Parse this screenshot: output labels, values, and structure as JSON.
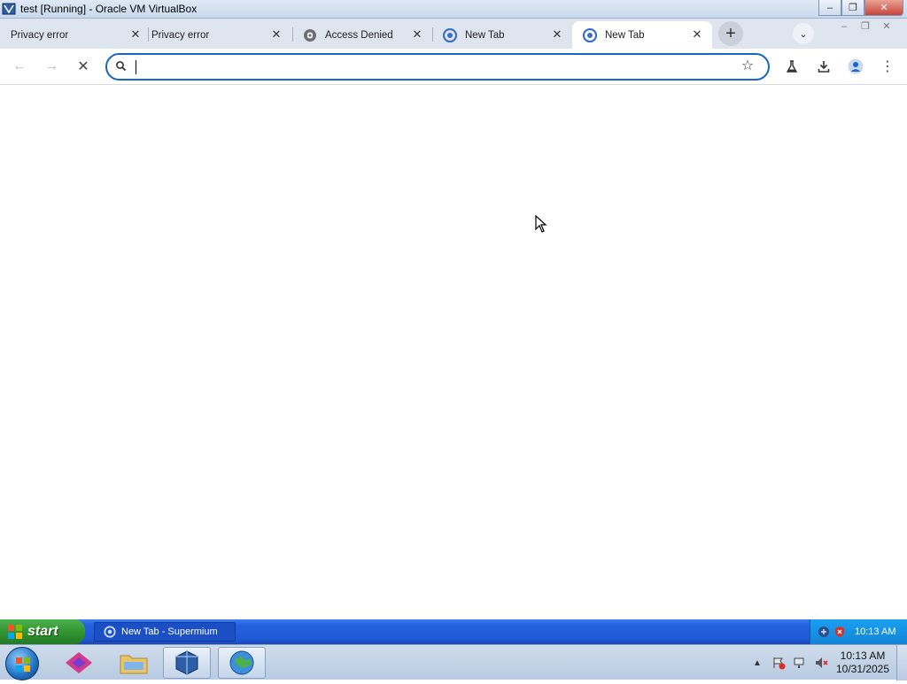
{
  "vbox": {
    "title": "test [Running] - Oracle VM VirtualBox",
    "icon": "virtualbox-icon"
  },
  "tabs": [
    {
      "title": "Privacy error",
      "favicon": "none",
      "active": false
    },
    {
      "title": "Privacy error",
      "favicon": "none",
      "active": false
    },
    {
      "title": "Access Denied",
      "favicon": "shield-icon",
      "active": false
    },
    {
      "title": "New Tab",
      "favicon": "supermium-icon",
      "active": false
    },
    {
      "title": "New Tab",
      "favicon": "supermium-icon",
      "active": true
    }
  ],
  "toolbar": {
    "omnibox_value": "",
    "omnibox_placeholder": ""
  },
  "xp_taskbar": {
    "start_label": "start",
    "task_label": "New Tab - Supermium",
    "clock": "10:13 AM"
  },
  "host_taskbar": {
    "time": "10:13 AM",
    "date": "10/31/2025"
  },
  "colors": {
    "accent": "#1a66c7",
    "tabstrip": "#dfe5ee",
    "xp_blue": "#2563e0",
    "xp_green": "#2d8f2d"
  }
}
